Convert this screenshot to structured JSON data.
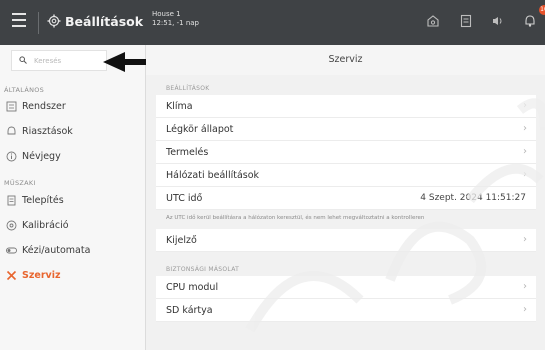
{
  "header": {
    "app_title": "Beállítások",
    "house_name": "House 1",
    "house_status": "12:51, -1 nap",
    "notification_count": "10"
  },
  "sidebar": {
    "search_placeholder": "Keresés",
    "section_general": "ÁLTALÁNOS",
    "general_items": [
      {
        "label": "Rendszer",
        "icon": "system-icon"
      },
      {
        "label": "Riasztások",
        "icon": "alarm-icon"
      },
      {
        "label": "Névjegy",
        "icon": "info-icon"
      }
    ],
    "section_technical": "MŰSZAKI",
    "technical_items": [
      {
        "label": "Telepítés",
        "icon": "install-icon"
      },
      {
        "label": "Kalibráció",
        "icon": "calibration-icon"
      },
      {
        "label": "Kézi/automata",
        "icon": "toggle-icon"
      },
      {
        "label": "Szerviz",
        "icon": "service-icon",
        "active": true
      }
    ]
  },
  "main": {
    "title": "Szerviz",
    "settings_label": "BEÁLLÍTÁSOK",
    "settings_rows": [
      {
        "label": "Klíma"
      },
      {
        "label": "Légkör állapot"
      },
      {
        "label": "Termelés"
      },
      {
        "label": "Hálózati beállítások"
      },
      {
        "label": "UTC idő",
        "value": "4 Szept. 2024 11:51:27"
      }
    ],
    "utc_note": "Az UTC idő kerül beállításra a hálózaton keresztül, és nem lehet megváltoztatni a kontrolleren",
    "display_row": {
      "label": "Kijelző"
    },
    "backup_label": "BIZTONSÁGI MÁSOLAT",
    "backup_rows": [
      {
        "label": "CPU modul"
      },
      {
        "label": "SD kártya"
      }
    ]
  },
  "colors": {
    "accent": "#e8652e",
    "topbar": "#3f4245",
    "badge": "#e8522a"
  }
}
